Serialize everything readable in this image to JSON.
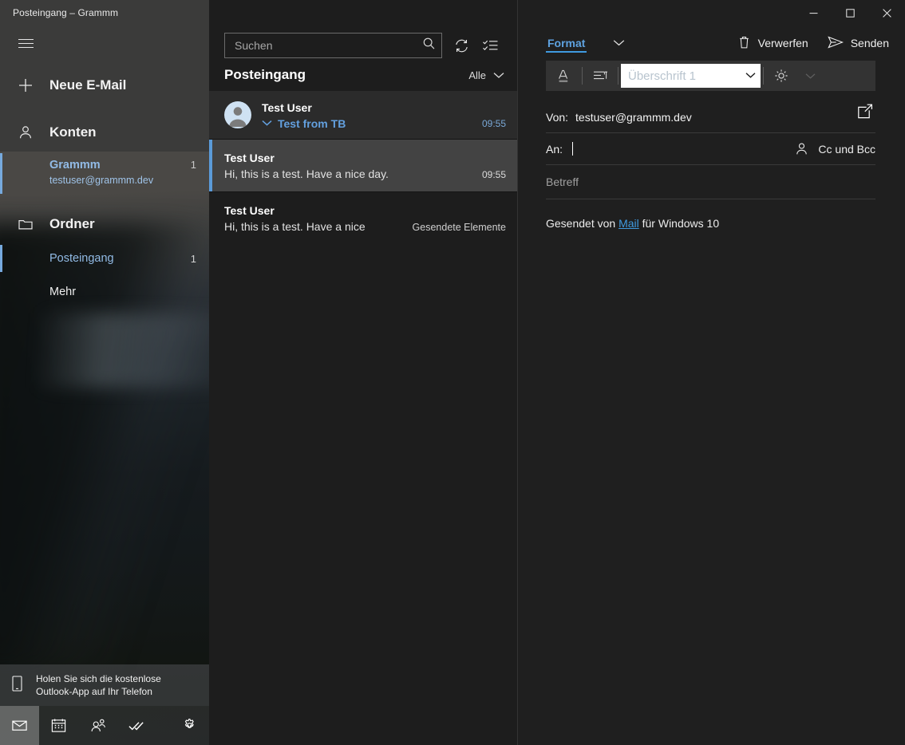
{
  "window": {
    "title": "Posteingang – Grammm",
    "controls": {
      "minimize": "minimize-icon",
      "maximize": "maximize-icon",
      "close": "close-icon"
    }
  },
  "sidebar": {
    "menu_button": "hamburger-icon",
    "new_mail": {
      "label": "Neue E-Mail",
      "icon": "plus-icon"
    },
    "accounts_section": {
      "label": "Konten",
      "icon": "person-icon"
    },
    "accounts": [
      {
        "name": "Grammm",
        "email": "testuser@grammm.dev",
        "count": "1",
        "selected": true
      }
    ],
    "folders_section": {
      "label": "Ordner",
      "icon": "folder-icon"
    },
    "folders": [
      {
        "label": "Posteingang",
        "count": "1",
        "selected": true
      },
      {
        "label": "Mehr",
        "count": "",
        "selected": false
      }
    ],
    "promo": {
      "icon": "phone-icon",
      "line1": "Holen Sie sich die kostenlose",
      "line2": "Outlook-App auf Ihr Telefon"
    },
    "nav": [
      {
        "name": "mail-icon",
        "active": true
      },
      {
        "name": "calendar-icon",
        "active": false
      },
      {
        "name": "people-icon",
        "active": false
      },
      {
        "name": "todo-icon",
        "active": false
      },
      {
        "name": "settings-icon",
        "active": false
      }
    ]
  },
  "list": {
    "search": {
      "placeholder": "Suchen",
      "icon": "search-icon"
    },
    "sync_icon": "sync-icon",
    "select_icon": "select-mode-icon",
    "header_title": "Posteingang",
    "filter": {
      "label": "Alle",
      "icon": "chevron-down-icon"
    },
    "conversation": {
      "sender": "Test User",
      "subject": "Test from TB",
      "time": "09:55",
      "expand_icon": "chevron-down-icon",
      "avatar": "avatar"
    },
    "messages": [
      {
        "sender": "Test User",
        "preview": "Hi, this is a test. Have a nice day.",
        "time": "09:55",
        "folder": "",
        "selected": true
      },
      {
        "sender": "Test User",
        "preview": "Hi, this is a test. Have a nice",
        "time": "",
        "folder": "Gesendete Elemente",
        "selected": false
      }
    ]
  },
  "compose": {
    "tab": {
      "label": "Format",
      "caret_icon": "chevron-down-icon"
    },
    "actions": [
      {
        "label": "Verwerfen",
        "icon": "trash-icon"
      },
      {
        "label": "Senden",
        "icon": "send-icon"
      }
    ],
    "ribbon": {
      "font_color_icon": "font-color-icon",
      "paragraph_icon": "paragraph-icon",
      "style_value": "Überschrift 1",
      "style_caret_icon": "chevron-down-icon",
      "styles_icon": "styles-icon",
      "overflow_icon": "chevron-down-icon"
    },
    "from": {
      "label": "Von:",
      "value": "testuser@grammm.dev"
    },
    "popout_icon": "popout-window-icon",
    "to": {
      "label": "An:",
      "value": "",
      "person_icon": "person-add-icon",
      "cc_bcc_label": "Cc und Bcc"
    },
    "subject": {
      "placeholder": "Betreff"
    },
    "signature": {
      "prefix": "Gesendet von ",
      "link": "Mail",
      "suffix": " für Windows 10"
    }
  },
  "colors": {
    "accent": "#3f9ae0",
    "selection_bar": "#5b9bd9",
    "sidebar_top": "#3b3b3a",
    "list_bg": "#1d1d1d",
    "compose_bg": "#1f1f1f",
    "selected_row": "#434343"
  }
}
